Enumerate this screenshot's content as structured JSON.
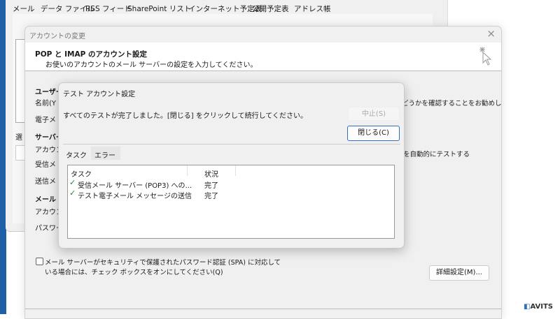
{
  "back_window": {
    "tabs": [
      "メール",
      "データ ファイル",
      "RSS フィード",
      "SharePoint リスト",
      "インターネット予定表",
      "公開予定表",
      "アドレス帳"
    ],
    "partial_label": "選"
  },
  "account_dialog": {
    "title": "アカウントの変更",
    "heading": "POP と IMAP のアカウント設定",
    "subheading": "お使いのアカウントのメール サーバーの設定を入力してください。",
    "labels": [
      {
        "text": "ユーザー",
        "bold": true
      },
      {
        "text": "名前(Y"
      },
      {
        "text": "電子メ"
      },
      {
        "text": "サーバー",
        "bold": true
      },
      {
        "text": "アカウン"
      },
      {
        "text": "受信メ"
      },
      {
        "text": "送信メ"
      },
      {
        "text": "メール ",
        "bold": true
      },
      {
        "text": "アカウン"
      },
      {
        "text": "パスワー"
      }
    ],
    "right_text_1": "どうかを確認することをお勧めし",
    "right_text_2": "を自動的にテストする",
    "spa_checkbox": {
      "checked": false,
      "line1": "メール サーバーがセキュリティで保護されたパスワード認証 (SPA) に対応して",
      "line2": "いる場合には、チェック ボックスをオンにしてください(Q)"
    },
    "advanced_button": "詳細設定(M)..."
  },
  "test_dialog": {
    "title": "テスト アカウント設定",
    "message": "すべてのテストが完了しました。[閉じる] をクリックして続行してください。",
    "stop_button": "中止(S)",
    "close_button": "閉じる(C)",
    "tabs": [
      "タスク",
      "エラー"
    ],
    "active_tab": "タスク",
    "columns": [
      "タスク",
      "状況"
    ],
    "rows": [
      {
        "task": "受信メール サーバー (POP3) への...",
        "status": "完了"
      },
      {
        "task": "テスト電子メール メッセージの送信",
        "status": "完了"
      }
    ]
  },
  "watermark": "AVITS",
  "colors": {
    "check": "#1e8a3a",
    "accent": "#2f6fbf",
    "desktop": "#1f5fa8"
  }
}
